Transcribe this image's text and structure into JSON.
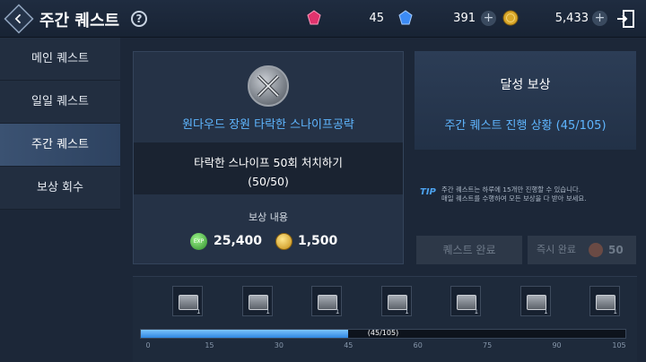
{
  "header": {
    "title": "주간 퀘스트",
    "help_icon": "help-icon",
    "currencies": [
      {
        "icon": "red-gem-icon",
        "color": "#e0336d",
        "value": "45",
        "has_plus": false
      },
      {
        "icon": "blue-gem-icon",
        "color": "#3c8bf5",
        "value": "391",
        "has_plus": true
      },
      {
        "icon": "gold-coin-icon",
        "color": "#d9a82a",
        "value": "5,433",
        "has_plus": true
      }
    ],
    "plus": "+"
  },
  "sidebar": {
    "items": [
      {
        "label": "메인 퀘스트",
        "active": false
      },
      {
        "label": "일일 퀘스트",
        "active": false
      },
      {
        "label": "주간 퀘스트",
        "active": true
      },
      {
        "label": "보상 회수",
        "active": false
      }
    ]
  },
  "quest": {
    "name": "원다우드 장원 타락한 스나이프공략",
    "objective": "타락한 스나이프 50회 처치하기",
    "progress": "(50/50)",
    "reward_label": "보상 내용",
    "rewards": [
      {
        "icon": "exp-icon",
        "icon_text": "EXP",
        "value": "25,400"
      },
      {
        "icon": "gold-coin-icon",
        "value": "1,500"
      }
    ]
  },
  "achievement": {
    "title": "달성 보상",
    "progress_text": "주간 퀘스트 진행 상황 (45/105)"
  },
  "tip": {
    "label": "TIP",
    "line1": "주간 퀘스트는 하루에 15개만 진행할 수 있습니다.",
    "line2": "매일 퀘스트를 수행하여 모든 보상을 다 받아 보세요."
  },
  "buttons": {
    "complete": "퀘스트 완료",
    "instant": "즉시 완료",
    "instant_cost": "50"
  },
  "milestones": {
    "current": 45,
    "max": 105,
    "bar_label": "(45/105)",
    "ticks": [
      "0",
      "15",
      "30",
      "45",
      "60",
      "75",
      "90",
      "105"
    ],
    "chests": [
      {
        "icon": "chest-icon",
        "count": "1"
      },
      {
        "icon": "chest-icon",
        "count": "1"
      },
      {
        "icon": "chest-icon",
        "count": "1"
      },
      {
        "icon": "chest-icon",
        "count": "1"
      },
      {
        "icon": "chest-icon",
        "count": "1"
      },
      {
        "icon": "chest-icon",
        "count": "1"
      },
      {
        "icon": "chest-icon",
        "count": "1"
      }
    ]
  }
}
